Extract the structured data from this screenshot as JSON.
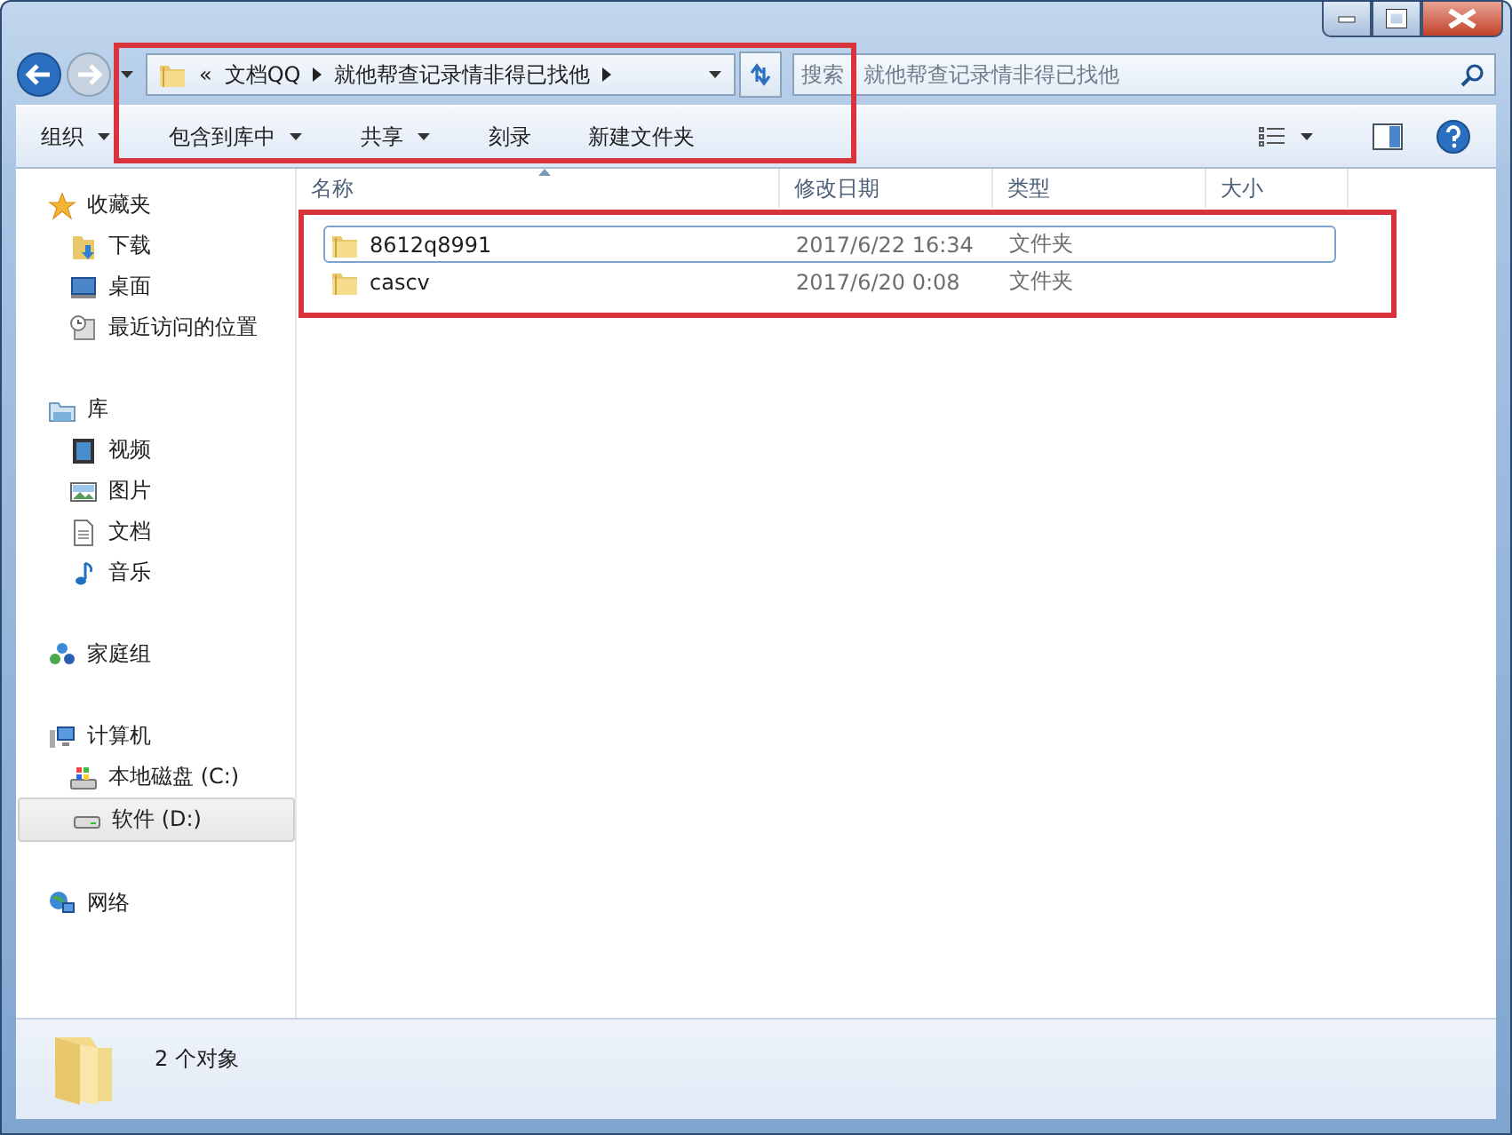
{
  "navigation": {
    "highlighted": true,
    "overflow": "«",
    "path": [
      {
        "label": "文档QQ"
      },
      {
        "label": "就他帮查记录情非得已找他"
      }
    ],
    "search": {
      "placeholder": "搜索 就他帮查记录情非得已找他"
    }
  },
  "toolbar": {
    "buttons": [
      {
        "label": "组织",
        "has_menu": true
      },
      {
        "label": "包含到库中",
        "has_menu": true
      },
      {
        "label": "共享",
        "has_menu": true
      },
      {
        "label": "刻录",
        "has_menu": false
      },
      {
        "label": "新建文件夹",
        "has_menu": false
      }
    ]
  },
  "sidebar": {
    "groups": [
      {
        "label": "收藏夹",
        "selected": false,
        "children": [
          {
            "label": "下载",
            "selected": false
          },
          {
            "label": "桌面",
            "selected": false
          },
          {
            "label": "最近访问的位置",
            "selected": false
          }
        ]
      },
      {
        "label": "库",
        "selected": false,
        "children": [
          {
            "label": "视频",
            "selected": false
          },
          {
            "label": "图片",
            "selected": false
          },
          {
            "label": "文档",
            "selected": false
          },
          {
            "label": "音乐",
            "selected": false
          }
        ]
      },
      {
        "label": "家庭组",
        "selected": false
      },
      {
        "label": "计算机",
        "selected": false,
        "children": [
          {
            "label": "本地磁盘 (C:)",
            "selected": false
          },
          {
            "label": "软件 (D:)",
            "selected": true
          }
        ]
      },
      {
        "label": "网络",
        "selected": false
      }
    ]
  },
  "files": {
    "highlighted": true,
    "columns": [
      {
        "label": "名称",
        "sorted": true
      },
      {
        "label": "修改日期",
        "sorted": false
      },
      {
        "label": "类型",
        "sorted": false
      },
      {
        "label": "大小",
        "sorted": false
      }
    ],
    "rows": [
      {
        "name": "8612q8991",
        "modified": "2017/6/22 16:34",
        "type": "文件夹",
        "focused": true
      },
      {
        "name": "cascv",
        "modified": "2017/6/20 0:08",
        "type": "文件夹",
        "focused": false
      }
    ]
  },
  "status_bar": {
    "text": "2 个对象"
  }
}
